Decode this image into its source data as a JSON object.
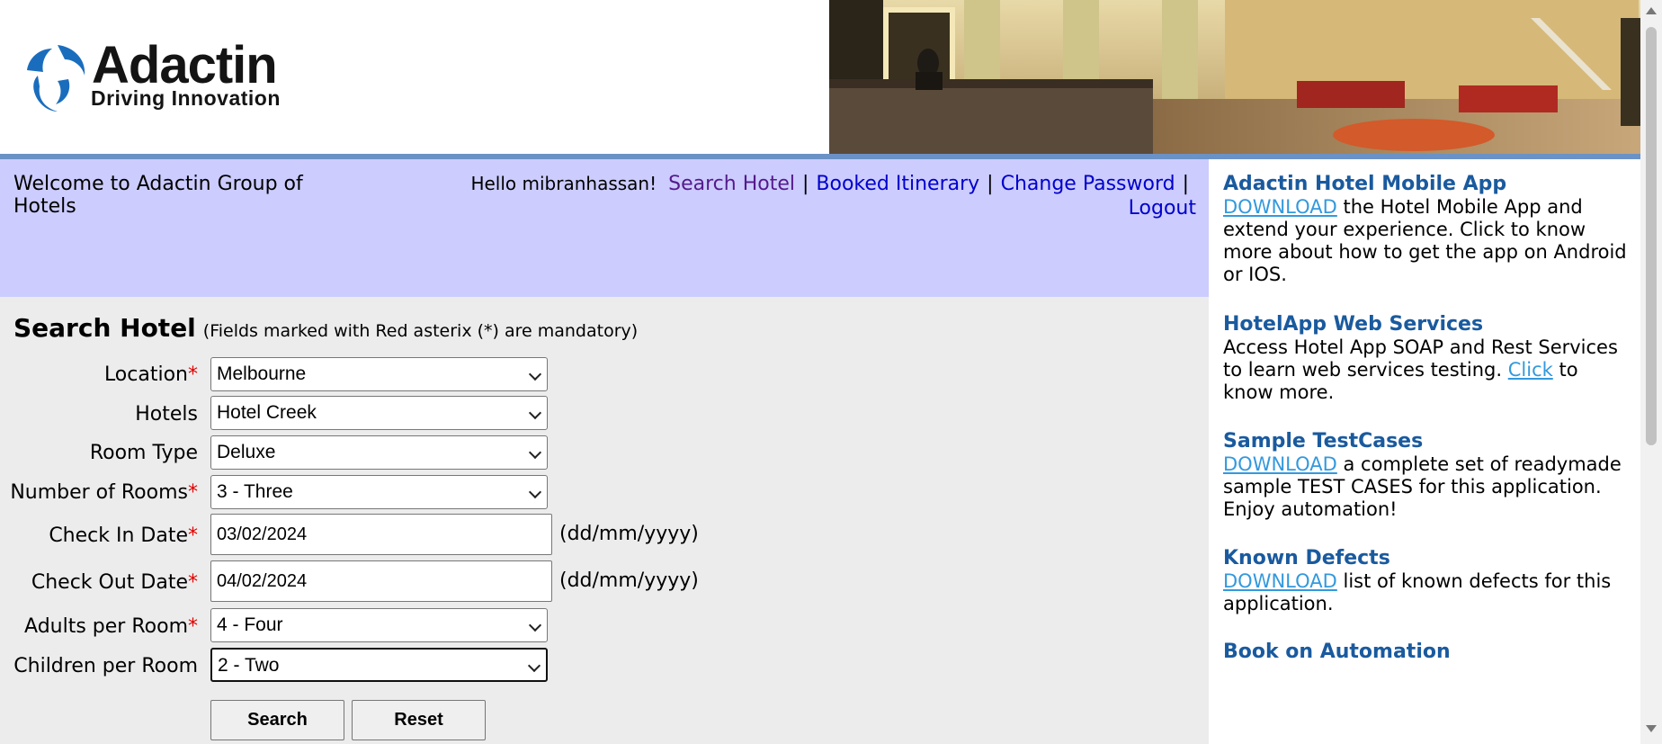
{
  "brand": {
    "name": "Adactin",
    "tagline": "Driving Innovation"
  },
  "nav": {
    "welcome": "Welcome to Adactin Group of Hotels",
    "hello": "Hello mibranhassan!",
    "links": [
      "Search Hotel",
      "Booked Itinerary",
      "Change Password",
      "Logout"
    ],
    "separator": "|"
  },
  "form": {
    "title": "Search Hotel",
    "note": "(Fields marked with Red asterix (*) are mandatory)",
    "required_mark": "*",
    "fields": {
      "location": {
        "label": "Location",
        "value": "Melbourne"
      },
      "hotels": {
        "label": "Hotels",
        "value": "Hotel Creek"
      },
      "room_type": {
        "label": "Room Type",
        "value": "Deluxe"
      },
      "rooms": {
        "label": "Number of Rooms",
        "value": "3 - Three"
      },
      "check_in": {
        "label": "Check In Date",
        "value": "03/02/2024",
        "format": "(dd/mm/yyyy)"
      },
      "check_out": {
        "label": "Check Out Date",
        "value": "04/02/2024",
        "format": "(dd/mm/yyyy)"
      },
      "adults": {
        "label": "Adults per Room",
        "value": "4 - Four"
      },
      "children": {
        "label": "Children per Room",
        "value": "2 - Two"
      }
    },
    "buttons": {
      "search": "Search",
      "reset": "Reset"
    }
  },
  "sidebar": {
    "mobile": {
      "title": "Adactin Hotel Mobile App",
      "link": "DOWNLOAD",
      "text": " the Hotel Mobile App and extend your experience. Click to know more about how to get the app on Android or IOS."
    },
    "webservices": {
      "title": "HotelApp Web Services",
      "text_before": "Access Hotel App SOAP and Rest Services to learn web services testing. ",
      "link": "Click",
      "text_after": " to know more."
    },
    "testcases": {
      "title": "Sample TestCases",
      "link": "DOWNLOAD",
      "text": " a complete set of readymade sample TEST CASES for this application. Enjoy automation!"
    },
    "defects": {
      "title": "Known Defects",
      "link": "DOWNLOAD",
      "text": " list of known defects for this application."
    },
    "book": {
      "title": "Book on Automation"
    }
  },
  "colors": {
    "nav_band": "#ccccff",
    "form_bg": "#ececec",
    "sidebar_title": "#1a5a9e",
    "link": "#0000cc",
    "required": "#e00000"
  },
  "icons": {
    "logo": "adactin-swirl-logo",
    "hero": "hotel-lobby-photo",
    "select_arrow": "chevron-down-icon"
  }
}
